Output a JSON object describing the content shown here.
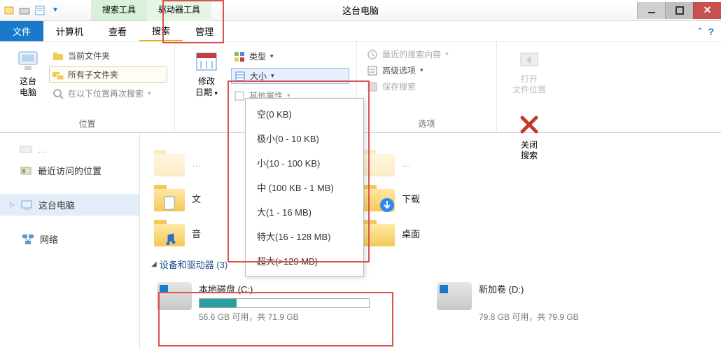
{
  "titlebar": {
    "tool_tabs": {
      "search": "搜索工具",
      "drive": "驱动器工具"
    },
    "title": "这台电脑"
  },
  "menubar": {
    "file": "文件",
    "computer": "计算机",
    "view": "查看",
    "search": "搜索",
    "manage": "管理"
  },
  "ribbon": {
    "location": {
      "thispc_label_1": "这台",
      "thispc_label_2": "电脑",
      "current_folder": "当前文件夹",
      "all_subfolders": "所有子文件夹",
      "search_again_in": "在以下位置再次搜索",
      "group_label": "位置"
    },
    "refine": {
      "date_label_1": "修改",
      "date_label_2": "日期",
      "type": "类型",
      "size": "大小",
      "other_props": "其他属性"
    },
    "options": {
      "recent": "最近的搜索内容",
      "advanced": "高级选项",
      "save": "保存搜索",
      "group_label": "选项"
    },
    "open_location": {
      "l1": "打开",
      "l2": "文件位置"
    },
    "close_search": {
      "l1": "关闭",
      "l2": "搜索"
    }
  },
  "size_dropdown": {
    "empty": "空(0 KB)",
    "tiny": "极小(0 - 10 KB)",
    "small": "小(10 - 100 KB)",
    "medium": "中 (100 KB - 1 MB)",
    "large": "大(1 - 16 MB)",
    "xlarge": "特大(16 - 128 MB)",
    "huge": "超大(>129 MB)"
  },
  "sidebar": {
    "recent_places": "最近访问的位置",
    "thispc": "这台电脑",
    "network": "网络"
  },
  "main": {
    "folder_row1_left": "文",
    "folder_row1_right": "下载",
    "folder_row2_left": "音",
    "folder_row2_right": "桌面",
    "devices_header": "设备和驱动器 (3)",
    "drive_c": {
      "name": "本地磁盘 (C:)",
      "stats": "56.6 GB 可用，共 71.9 GB",
      "fill_pct": 22
    },
    "drive_d": {
      "name": "新加卷 (D:)",
      "stats": "79.8 GB 可用，共 79.9 GB"
    }
  }
}
